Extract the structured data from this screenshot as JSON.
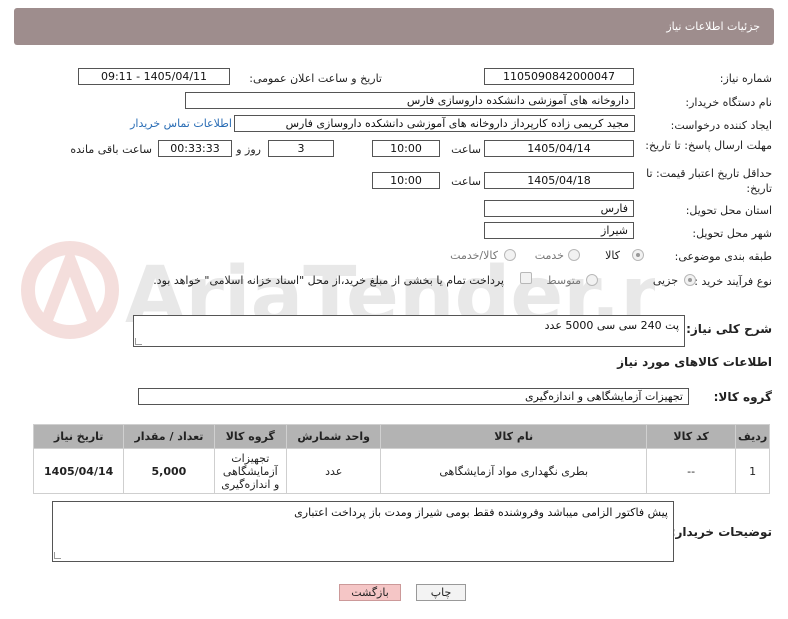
{
  "header": {
    "title": "جزئیات اطلاعات نیاز"
  },
  "labels": {
    "need_number": "شماره نیاز:",
    "announce_datetime": "تاریخ و ساعت اعلان عمومی:",
    "buyer_org": "نام دستگاه خریدار:",
    "requester": "ایجاد کننده درخواست:",
    "reply_deadline": "مهلت ارسال پاسخ: تا تاریخ:",
    "hour": "ساعت",
    "day_and": "روز و",
    "hours_left": "ساعت باقی مانده",
    "min_validity": "حداقل تاریخ اعتبار قیمت: تا تاریخ:",
    "province": "استان محل تحویل:",
    "city": "شهر محل تحویل:",
    "category": "طبقه بندی موضوعی:",
    "process_type": "نوع فرآیند خرید :",
    "description": "شرح کلی نیاز:",
    "goods_info": "اطلاعات کالاهای مورد نیاز",
    "goods_group": "گروه کالا:",
    "buyer_notes": "توضیحات خریدار:"
  },
  "values": {
    "need_number": "1105090842000047",
    "announce_datetime": "1405/04/11 - 09:11",
    "buyer_org": "داروخانه های آموزشی دانشکده داروسازی فارس",
    "requester": "مجید کریمی زاده کارپرداز داروخانه های آموزشی دانشکده داروسازی فارس",
    "contact_link": "اطلاعات تماس خریدار",
    "reply_date": "1405/04/14",
    "reply_time": "10:00",
    "days": "3",
    "remaining": "00:33:33",
    "validity_date": "1405/04/18",
    "validity_time": "10:00",
    "province": "فارس",
    "city": "شیراز",
    "description": "پت  240 سی سی 5000 عدد",
    "goods_group": "تجهیزات آزمایشگاهی و اندازه‌گیری",
    "buyer_notes": "پیش فاکتور الزامی میباشد وفروشنده فقط بومی شیراز ومدت باز پرداخت اعتباری"
  },
  "category_options": [
    "کالا",
    "خدمت",
    "کالا/خدمت"
  ],
  "process_options": [
    "جزیی",
    "متوسط"
  ],
  "process_note": "پرداخت تمام یا بخشی از مبلغ خرید،از محل \"اسناد خزانه اسلامی\" خواهد بود.",
  "table": {
    "headers": [
      "ردیف",
      "کد کالا",
      "نام کالا",
      "واحد شمارش",
      "گروه کالا",
      "تعداد / مقدار",
      "تاریخ نیاز"
    ],
    "rows": [
      [
        "1",
        "--",
        "بطری نگهداری مواد آزمایشگاهی",
        "عدد",
        "تجهیزات آزمایشگاهی و اندازه‌گیری",
        "5,000",
        "1405/04/14"
      ]
    ]
  },
  "buttons": {
    "print": "چاپ",
    "back": "بازگشت"
  },
  "watermark": "AriaTender.net",
  "colors": {
    "header_bg": "#9e8d8d",
    "table_header_bg": "#b3b3b3",
    "link": "#2a6db5",
    "back_button": "#f5c6c6"
  }
}
